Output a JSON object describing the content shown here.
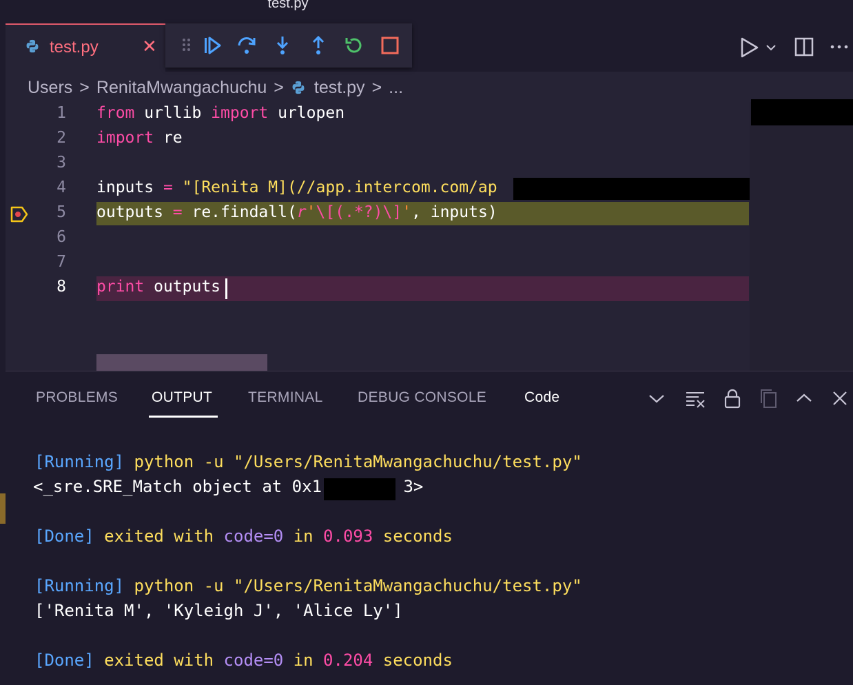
{
  "window": {
    "title": "test.py"
  },
  "tab": {
    "label": "test.py",
    "close_glyph": "✕"
  },
  "debug_toolbar": {
    "items": [
      "grip-icon",
      "continue-icon",
      "step-over-icon",
      "step-into-icon",
      "step-out-icon",
      "restart-icon",
      "stop-icon"
    ]
  },
  "editor_actions": {
    "items": [
      "run-icon",
      "chevron-down-icon",
      "split-editor-icon",
      "more-icon"
    ]
  },
  "breadcrumb": {
    "items": [
      "Users",
      "RenitaMwangachuchu",
      "test.py",
      "..."
    ],
    "separator": ">"
  },
  "editor": {
    "line_numbers": [
      "1",
      "2",
      "3",
      "4",
      "5",
      "6",
      "7",
      "8"
    ],
    "lines": {
      "l1": {
        "kw1": "from",
        "mod": " urllib ",
        "kw2": "import",
        "name": " urlopen"
      },
      "l2": {
        "kw": "import",
        "name": " re"
      },
      "l4": {
        "name": "inputs ",
        "eq": "=",
        "str": " \"[Renita M](//app.intercom.com/ap"
      },
      "l5": {
        "name": "outputs ",
        "eq": "=",
        "call": " re.findall(",
        "prefix": "r",
        "q1": "'",
        "esc1": "\\[",
        "grp": "(.*?)",
        "esc2": "\\]",
        "q2": "'",
        "rest": ", inputs)"
      },
      "l8": {
        "kw": "print",
        "name": " outputs"
      }
    },
    "breakpoint_line": "5",
    "active_line": "8"
  },
  "panel": {
    "tabs": [
      "PROBLEMS",
      "OUTPUT",
      "TERMINAL",
      "DEBUG CONSOLE"
    ],
    "active_tab": "OUTPUT",
    "channel": "Code",
    "icons": [
      "chevron-down-icon",
      "clear-output-icon",
      "lock-icon",
      "copy-icon",
      "chevron-up-icon",
      "close-icon"
    ],
    "output": {
      "run1_tag": "[Running]",
      "run1_cmd": " python -u \"/Users/RenitaMwangachuchu/test.py\"",
      "result1_a": "<_sre.SRE_Match object at 0x1(",
      "result1_b": "3>",
      "done1_tag": "[Done]",
      "done1_a": " exited with ",
      "done1_code": "code=0",
      "done1_b": " in ",
      "done1_time": "0.093",
      "done1_c": " seconds",
      "run2_tag": "[Running]",
      "run2_cmd": " python -u \"/Users/RenitaMwangachuchu/test.py\"",
      "result2": "['Renita M', 'Kyleigh J', 'Alice Ly']",
      "done2_tag": "[Done]",
      "done2_a": " exited with ",
      "done2_code": "code=0",
      "done2_b": " in ",
      "done2_time": "0.204",
      "done2_c": " seconds"
    }
  },
  "colors": {
    "background": "#262335",
    "keyword": "#fe4ca6",
    "string": "#ff8b39",
    "accent_tab": "#ff6f7f",
    "output_blue": "#5aa7ff",
    "output_yellow": "#fede5d"
  }
}
